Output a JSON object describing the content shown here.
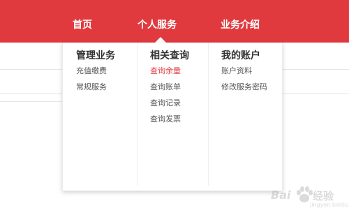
{
  "nav": {
    "home_label": "首页",
    "services_label": "个人服务",
    "intro_label": "业务介绍"
  },
  "dropdown": {
    "columns": [
      {
        "title": "管理业务",
        "items": [
          "充值缴费",
          "常规服务"
        ]
      },
      {
        "title": "相关查询",
        "items": [
          "查询余量",
          "查询账单",
          "查询记录",
          "查询发票"
        ],
        "active_index": 0
      },
      {
        "title": "我的账户",
        "items": [
          "账户资料",
          "修改服务密码"
        ]
      }
    ]
  },
  "watermark": {
    "brand_left": "Bai",
    "brand_right": "经验",
    "sub": "jingyan.baidu.com"
  },
  "colors": {
    "brand_red": "#e03a3e",
    "link_gray": "#555555",
    "title_gray": "#333333"
  }
}
